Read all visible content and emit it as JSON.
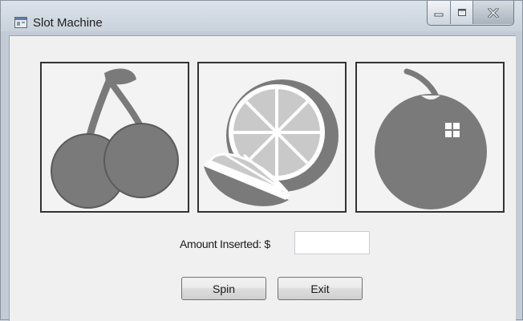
{
  "window": {
    "title": "Slot Machine"
  },
  "reels": [
    {
      "symbol": "cherries-icon"
    },
    {
      "symbol": "orange-icon"
    },
    {
      "symbol": "apple-icon"
    }
  ],
  "form": {
    "amount_label": "Amount Inserted: $",
    "amount_value": ""
  },
  "buttons": {
    "spin_label": "Spin",
    "exit_label": "Exit"
  },
  "colors": {
    "fruit": "#7a7a7a",
    "reel_bg": "#f3f3f3",
    "reel_border": "#333333"
  }
}
